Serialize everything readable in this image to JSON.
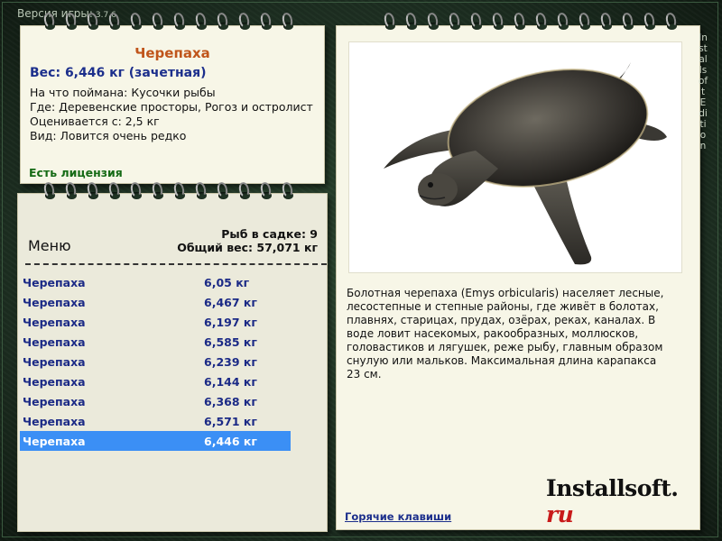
{
  "app": {
    "version_label": "Версия игры:",
    "version_number": "3.7.6",
    "side_label": "Installsoft Edition"
  },
  "info": {
    "fish_name": "Черепаха",
    "weight": "Вес: 6,446 кг (зачетная)",
    "details": [
      "На что поймана: Кусочки рыбы",
      "Где: Деревенские просторы, Рогоз и остролист",
      "Оценивается с: 2,5 кг",
      "Вид: Ловится очень редко"
    ],
    "license": "Есть лицензия"
  },
  "menu": {
    "title": "Меню",
    "fish_count": "Рыб в садке: 9",
    "total_weight": "Общий вес: 57,071 кг",
    "catches": [
      {
        "name": "Черепаха",
        "weight": "6,05 кг"
      },
      {
        "name": "Черепаха",
        "weight": "6,467 кг"
      },
      {
        "name": "Черепаха",
        "weight": "6,197 кг"
      },
      {
        "name": "Черепаха",
        "weight": "6,585 кг"
      },
      {
        "name": "Черепаха",
        "weight": "6,239 кг"
      },
      {
        "name": "Черепаха",
        "weight": "6,144 кг"
      },
      {
        "name": "Черепаха",
        "weight": "6,368 кг"
      },
      {
        "name": "Черепаха",
        "weight": "6,571 кг"
      },
      {
        "name": "Черепаха",
        "weight": "6,446 кг"
      }
    ],
    "selected_index": 8
  },
  "description": {
    "text": "Болотная черепаха (Emys orbicularis) населяет лесные, лесостепные и степные районы, где живёт в болотах, плавнях, старицах, прудах, озёрах, реках, каналах. В воде ловит насекомых, ракообразных, моллюсков, головастиков и лягушек, реже рыбу, главным образом снулую или мальков. Максимальная длина карапакса 23 см.",
    "logo_main": "Installsoft.",
    "logo_ru": "ru",
    "hotkeys_link": "Горячие клавиши"
  },
  "colors": {
    "fish_name": "#c0551b",
    "weight": "#1c2f8c",
    "license": "#156a15",
    "selected_row": "#3b8ff5"
  },
  "icons": [
    "turtle-photo",
    "spiral-ring"
  ]
}
